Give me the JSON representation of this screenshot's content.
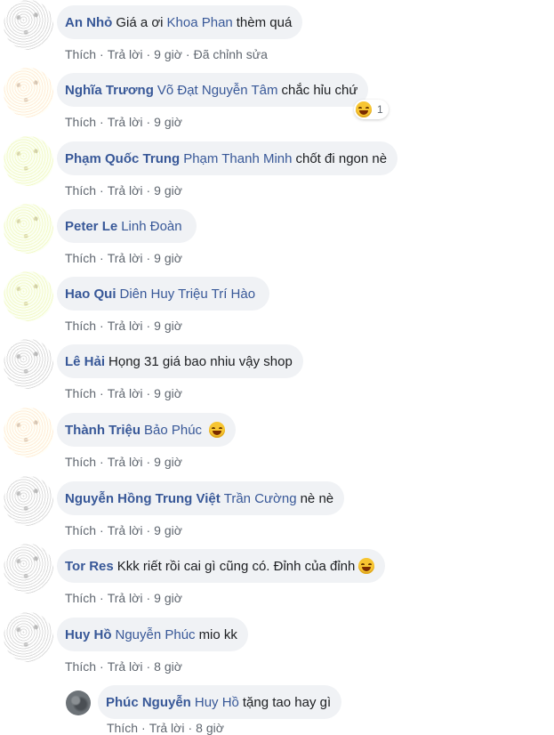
{
  "comments": [
    {
      "author": "An Nhỏ",
      "mention": "",
      "text_pre": "Giá a ơi",
      "mention2": "Khoa Phan",
      "text": "thèm quá",
      "emoji": "",
      "meta": [
        "Thích",
        "Trả lời",
        "9 giờ",
        "Đã chỉnh sửa"
      ]
    },
    {
      "author": "Nghĩa Trương",
      "mention": "Võ Đạt Nguyễn Tâm",
      "text": "chắc hỉu chứ",
      "emoji": "",
      "reaction_count": "1",
      "reaction_icon": "laughing-emoji-icon",
      "meta": [
        "Thích",
        "Trả lời",
        "9 giờ"
      ]
    },
    {
      "author": "Phạm Quốc Trung",
      "mention": "Phạm Thanh Minh",
      "text": "chốt đi ngon nè",
      "emoji": "",
      "meta": [
        "Thích",
        "Trả lời",
        "9 giờ"
      ]
    },
    {
      "author": "Peter Le",
      "mention": "Linh Đoàn",
      "text": "",
      "emoji": "",
      "meta": [
        "Thích",
        "Trả lời",
        "9 giờ"
      ]
    },
    {
      "author": "Hao Qui",
      "mention": "Diên Huy Triệu Trí Hào",
      "text": "",
      "emoji": "",
      "meta": [
        "Thích",
        "Trả lời",
        "9 giờ"
      ]
    },
    {
      "author": "Lê Hải",
      "mention": "",
      "text": "Họng 31 giá bao nhiu vậy shop",
      "emoji": "",
      "meta": [
        "Thích",
        "Trả lời",
        "9 giờ"
      ]
    },
    {
      "author": "Thành Triệu",
      "mention": "Bảo Phúc",
      "text": "",
      "emoji": "laughing-tears-emoji-icon",
      "meta": [
        "Thích",
        "Trả lời",
        "9 giờ"
      ]
    },
    {
      "author": "Nguyễn Hồng Trung Việt",
      "mention": "Trần Cường",
      "text": "nè nè",
      "emoji": "",
      "meta": [
        "Thích",
        "Trả lời",
        "9 giờ"
      ]
    },
    {
      "author": "Tor Res",
      "mention": "",
      "text": "Kkk riết rồi cai gì cũng có. Đỉnh của đỉnh",
      "emoji": "grinning-emoji-icon",
      "meta": [
        "Thích",
        "Trả lời",
        "9 giờ"
      ]
    },
    {
      "author": "Huy Hồ",
      "mention": "Nguyễn Phúc",
      "text": "mio kk",
      "emoji": "",
      "meta": [
        "Thích",
        "Trả lời",
        "8 giờ"
      ]
    }
  ],
  "reply": {
    "author": "Phúc Nguyễn",
    "mention": "Huy Hồ",
    "text": "tặng tao hay gì",
    "meta": [
      "Thích",
      "Trả lời",
      "8 giờ"
    ]
  },
  "colors": {
    "link": "#385898",
    "bubble": "#f0f2f5",
    "meta": "#606770"
  }
}
